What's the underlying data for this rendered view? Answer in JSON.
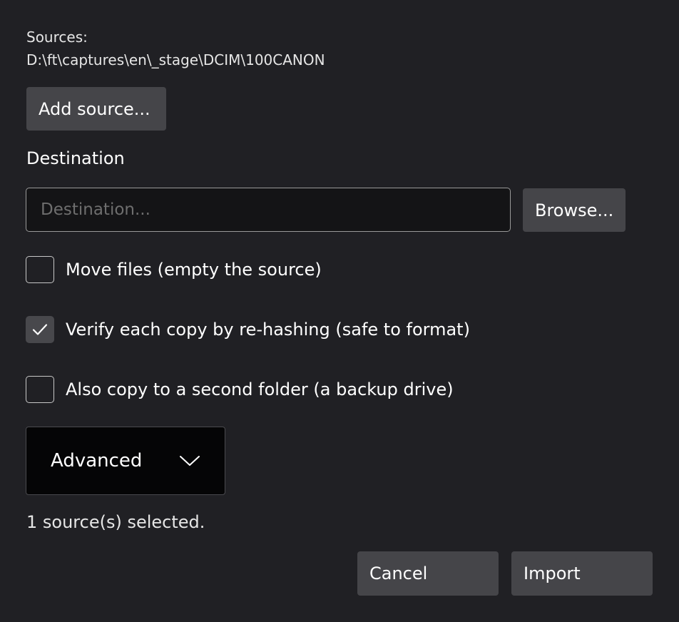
{
  "sources": {
    "label": "Sources:",
    "path": "D:\\ft\\captures\\en\\_stage\\DCIM\\100CANON",
    "add_button": "Add source..."
  },
  "destination": {
    "title": "Destination",
    "placeholder": "Destination...",
    "value": "",
    "browse_button": "Browse..."
  },
  "options": [
    {
      "label": "Move files (empty the source)",
      "checked": false
    },
    {
      "label": "Verify each copy by re-hashing (safe to format)",
      "checked": true
    },
    {
      "label": "Also copy to a second folder (a backup drive)",
      "checked": false
    }
  ],
  "advanced": {
    "label": "Advanced",
    "icon": "chevron-down-icon"
  },
  "status": "1 source(s) selected.",
  "actions": {
    "cancel": "Cancel",
    "import": "Import"
  },
  "colors": {
    "background": "#202024",
    "button": "#454549",
    "input_bg": "#141416"
  }
}
